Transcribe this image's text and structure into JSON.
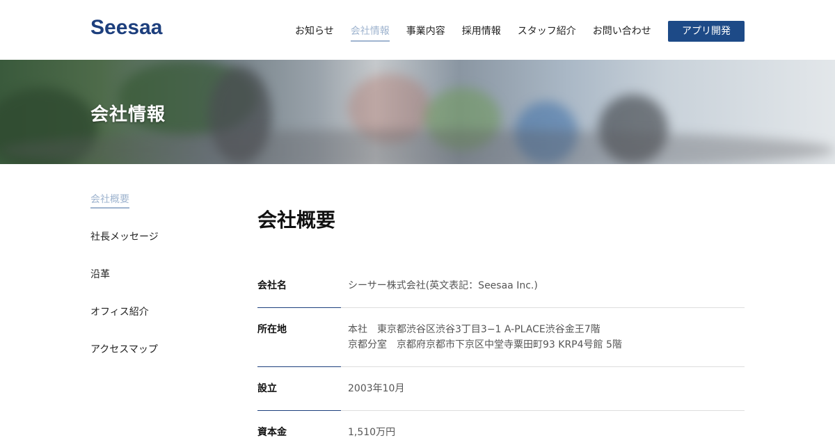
{
  "header": {
    "logo": "Seesaa",
    "nav": [
      "お知らせ",
      "会社情報",
      "事業内容",
      "採用情報",
      "スタッフ紹介",
      "お問い合わせ"
    ],
    "active_nav": "会社情報",
    "cta_label": "アプリ開発"
  },
  "hero": {
    "title": "会社情報"
  },
  "sidebar": {
    "items": [
      "会社概要",
      "社長メッセージ",
      "沿革",
      "オフィス紹介",
      "アクセスマップ"
    ],
    "active": "会社概要"
  },
  "main": {
    "title": "会社概要",
    "rows": [
      {
        "key": "会社名",
        "values": [
          "シーサー株式会社(英文表記：Seesaa Inc.)"
        ]
      },
      {
        "key": "所在地",
        "values": [
          "本社　東京都渋谷区渋谷3丁目3−1 A-PLACE渋谷金王7階",
          "京都分室　京都府京都市下京区中堂寺粟田町93 KRP4号館 5階"
        ]
      },
      {
        "key": "設立",
        "values": [
          "2003年10月"
        ]
      },
      {
        "key": "資本金",
        "values": [
          "1,510万円"
        ]
      }
    ]
  },
  "colors": {
    "brand": "#1d3f7d",
    "cta": "#1d4a87",
    "active": "#9fb4cf"
  }
}
